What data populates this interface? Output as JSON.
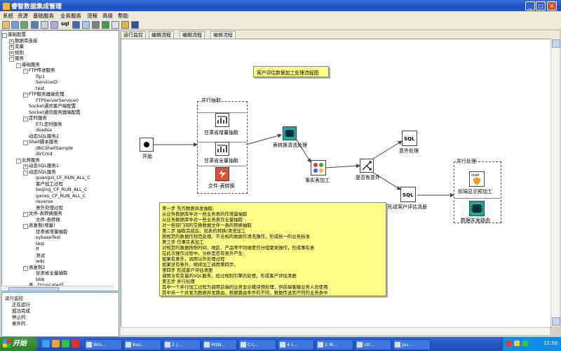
{
  "window": {
    "title": "睿智数据集成管理"
  },
  "menu": [
    "系统",
    "资源",
    "基础服务",
    "业务服务",
    "流程",
    "高级",
    "帮助"
  ],
  "toolbar": {
    "sql_label": "sql"
  },
  "tree": {
    "root": "基础配置",
    "nodes": [
      {
        "label": "基础配置",
        "depth": 0,
        "expander": "-"
      },
      {
        "label": "数据库连接",
        "depth": 1,
        "expander": "+"
      },
      {
        "label": "变量",
        "depth": 1,
        "expander": "+"
      },
      {
        "label": "规则",
        "depth": 1,
        "expander": "+"
      },
      {
        "label": "服务",
        "depth": 1,
        "expander": "-"
      },
      {
        "label": "基础服务",
        "depth": 2,
        "expander": "-"
      },
      {
        "label": "FTP传送服务",
        "depth": 3,
        "expander": "-"
      },
      {
        "label": "ftp1",
        "depth": 4,
        "expander": ""
      },
      {
        "label": "ServiceID",
        "depth": 4,
        "expander": ""
      },
      {
        "label": "test",
        "depth": 4,
        "expander": ""
      },
      {
        "label": "FTP服务器端处理",
        "depth": 3,
        "expander": "-"
      },
      {
        "label": "FTPServerService0",
        "depth": 4,
        "expander": ""
      },
      {
        "label": "Socket通讯客户端配置",
        "depth": 3,
        "expander": ""
      },
      {
        "label": "Socket通讯服务器端配置",
        "depth": 3,
        "expander": ""
      },
      {
        "label": "定时服务",
        "depth": 3,
        "expander": "-"
      },
      {
        "label": "ETL定时服务",
        "depth": 4,
        "expander": ""
      },
      {
        "label": "dsadsa",
        "depth": 4,
        "expander": ""
      },
      {
        "label": "动态SQL服务2",
        "depth": 3,
        "expander": ""
      },
      {
        "label": "Shell脚本服务",
        "depth": 3,
        "expander": "-"
      },
      {
        "label": "dbCShellSample",
        "depth": 4,
        "expander": ""
      },
      {
        "label": "dirCmd",
        "depth": 4,
        "expander": ""
      },
      {
        "label": "业务服务",
        "depth": 2,
        "expander": "-"
      },
      {
        "label": "动态SQL服务1",
        "depth": 3,
        "expander": "+"
      },
      {
        "label": "动态SQL服务",
        "depth": 3,
        "expander": "-"
      },
      {
        "label": "guangxi_CF_RUN_ALL_C",
        "depth": 4,
        "expander": ""
      },
      {
        "label": "客户加工过程",
        "depth": 4,
        "expander": ""
      },
      {
        "label": "beijing_CF_RUN_ALL_C",
        "depth": 4,
        "expander": ""
      },
      {
        "label": "gansu_CF_RUN_ALL_C",
        "depth": 4,
        "expander": ""
      },
      {
        "label": "reverse",
        "depth": 4,
        "expander": ""
      },
      {
        "label": "意外处理过程",
        "depth": 4,
        "expander": ""
      },
      {
        "label": "文件-表转换服务",
        "depth": 3,
        "expander": "-"
      },
      {
        "label": "文件-表转换",
        "depth": 4,
        "expander": ""
      },
      {
        "label": "表复制(增量)",
        "depth": 3,
        "expander": "-"
      },
      {
        "label": "甘肃省增量抽取",
        "depth": 4,
        "expander": ""
      },
      {
        "label": "sybaseTest",
        "depth": 4,
        "expander": ""
      },
      {
        "label": "test",
        "depth": 4,
        "expander": ""
      },
      {
        "label": "ff",
        "depth": 4,
        "expander": ""
      },
      {
        "label": "测试",
        "depth": 4,
        "expander": ""
      },
      {
        "label": "wdc",
        "depth": 4,
        "expander": ""
      },
      {
        "label": "表复制2",
        "depth": 3,
        "expander": "-"
      },
      {
        "label": "甘肃省全量抽取",
        "depth": 4,
        "expander": ""
      },
      {
        "label": "bbb",
        "depth": 4,
        "expander": ""
      },
      {
        "label": "表...[truncated]",
        "depth": 3,
        "expander": ""
      }
    ]
  },
  "status_panel": {
    "title": "运行监控",
    "items": [
      "正在运行",
      "成功完成",
      "停止的",
      "意外的"
    ]
  },
  "tabs": [
    "运行监控",
    "编辑流程",
    "编辑流程",
    "编辑流程"
  ],
  "diagram": {
    "title_note": "客户评估数据加工处理流程图",
    "parallel_extract_label": "并行抽取",
    "parallel_process_label": "并行处理",
    "nodes": {
      "start": "开始",
      "gansu_incr": "甘肃省增量抽取",
      "gansu_full": "甘肃省全量抽取",
      "file_table": "文件-表转换",
      "table_clean": "表转换清洗处理",
      "fact_proc": "事实表加工",
      "has_exception": "是否有意外",
      "exception_proc": "意外处理",
      "customer_eval": "形成客户评估清册",
      "front_display": "前端显示预加工",
      "data_route": "数据并发路由"
    },
    "steps_note": [
      "第一步  先作数据并发抽取:",
      "            从业务数据库中对一些业务表的作增量抽取",
      "            从业务数据库中对一些业务表作全量抽取",
      "            对一些部门间的交换数据文件一表的转换抽取",
      "第二步  抽取完成后，就表的转换/清洗加工",
      "            按规范的数据作规范处理，不合规的数据作清洗操作，形成统一的业务标准",
      "第三步  作事实表加工",
      "            对规范的数据按照时间、地区、产品等不同维度作分组聚类操作，形成事实表",
      "            在此次操作过程中，分析是否有意外产生:",
      "                如果有意外，调用以外处理过程",
      "                如果没有意外，继续加工调用第四步。",
      "第四步  形成客户评估清册",
      "            调用含有变量的SQL服务，经过规则引擎的处理，形成客户评估清册",
      "第五步  并行处理",
      "            其中一个并行加工过程为调用前端的业务显示模块预处理，供前端客服业务人员使用",
      "            其中另一个并发为数据并发路由，根据路由条件的不同，数据传送到不同的业务表中"
    ]
  },
  "taskbar": {
    "start_label": "开始",
    "tasks": [
      "Win...",
      "Bas...",
      "2 J...",
      "MSN...",
      "C:\\...",
      "4 I...",
      "2 M...",
      "Ult...",
      "Jav..."
    ],
    "clock": "12:50"
  },
  "colors": {
    "title_bar": "#1c4fc3",
    "note": "#ffff88",
    "taskbar": "#2458c4",
    "tray": "#0f8ee6"
  }
}
